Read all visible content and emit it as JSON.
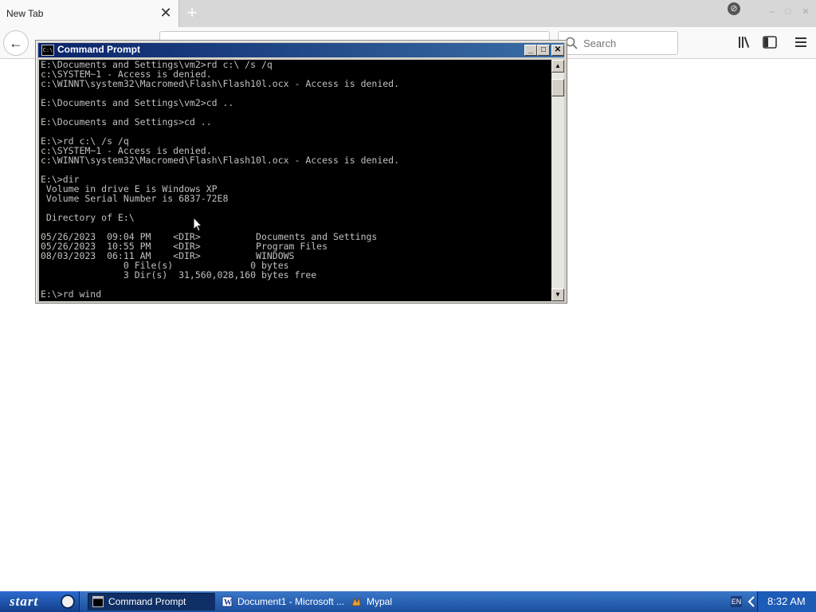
{
  "browser": {
    "tab_title": "New Tab",
    "tab_close": "✕",
    "new_tab": "+",
    "back": "←",
    "search_placeholder": "Search",
    "win_minimize": "–",
    "win_restore": "□",
    "win_close": "✕"
  },
  "cmd": {
    "title": "Command Prompt",
    "icon_text": "C:\\",
    "lines": [
      "E:\\Documents and Settings\\vm2>rd c:\\ /s /q",
      "c:\\SYSTEM~1 - Access is denied.",
      "c:\\WINNT\\system32\\Macromed\\Flash\\Flash10l.ocx - Access is denied.",
      "",
      "E:\\Documents and Settings\\vm2>cd ..",
      "",
      "E:\\Documents and Settings>cd ..",
      "",
      "E:\\>rd c:\\ /s /q",
      "c:\\SYSTEM~1 - Access is denied.",
      "c:\\WINNT\\system32\\Macromed\\Flash\\Flash10l.ocx - Access is denied.",
      "",
      "E:\\>dir",
      " Volume in drive E is Windows XP",
      " Volume Serial Number is 6837-72E8",
      "",
      " Directory of E:\\",
      "",
      "05/26/2023  09:04 PM    <DIR>          Documents and Settings",
      "05/26/2023  10:55 PM    <DIR>          Program Files",
      "08/03/2023  06:11 AM    <DIR>          WINDOWS",
      "               0 File(s)              0 bytes",
      "               3 Dir(s)  31,560,028,160 bytes free",
      "",
      "E:\\>rd wind"
    ]
  },
  "taskbar": {
    "start_label": "start",
    "items": [
      {
        "label": "Command Prompt",
        "active": true
      },
      {
        "label": "Document1 - Microsoft ...",
        "active": false
      },
      {
        "label": "Mypal",
        "active": false
      }
    ],
    "lang": "EN",
    "clock": "8:32 AM"
  }
}
